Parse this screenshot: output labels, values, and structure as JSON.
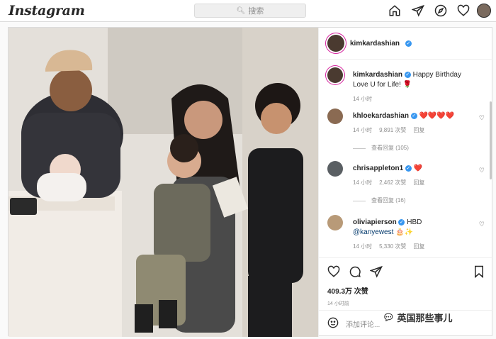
{
  "header": {
    "logo": "Instagram",
    "search_placeholder": "搜索"
  },
  "post": {
    "author": "kimkardashian",
    "caption_line1": "Happy Birthday",
    "caption_line2": "Love U for Life!",
    "caption_time": "14 小时",
    "comments": [
      {
        "user": "khloekardashian",
        "text": "❤️❤️❤️❤️",
        "time": "14 小时",
        "likes": "9,891 次赞",
        "reply": "回复",
        "view_replies": "查看回复 (105)"
      },
      {
        "user": "chrisappleton1",
        "text": "❤️",
        "time": "14 小时",
        "likes": "2,462 次赞",
        "reply": "回复",
        "view_replies": "查看回复 (16)"
      },
      {
        "user": "oliviapierson",
        "text": "HBD",
        "mention": "@kanyewest",
        "time": "14 小时",
        "likes": "5,330 次赞",
        "reply": "回复"
      }
    ],
    "likes": "409.3万 次赞",
    "time": "14 小时前",
    "add_comment_placeholder": "添加评论..."
  },
  "watermark": "英国那些事儿",
  "colors": {
    "accent": "#3897f0",
    "heart": "#ed4956",
    "border": "#dbdbdb"
  }
}
